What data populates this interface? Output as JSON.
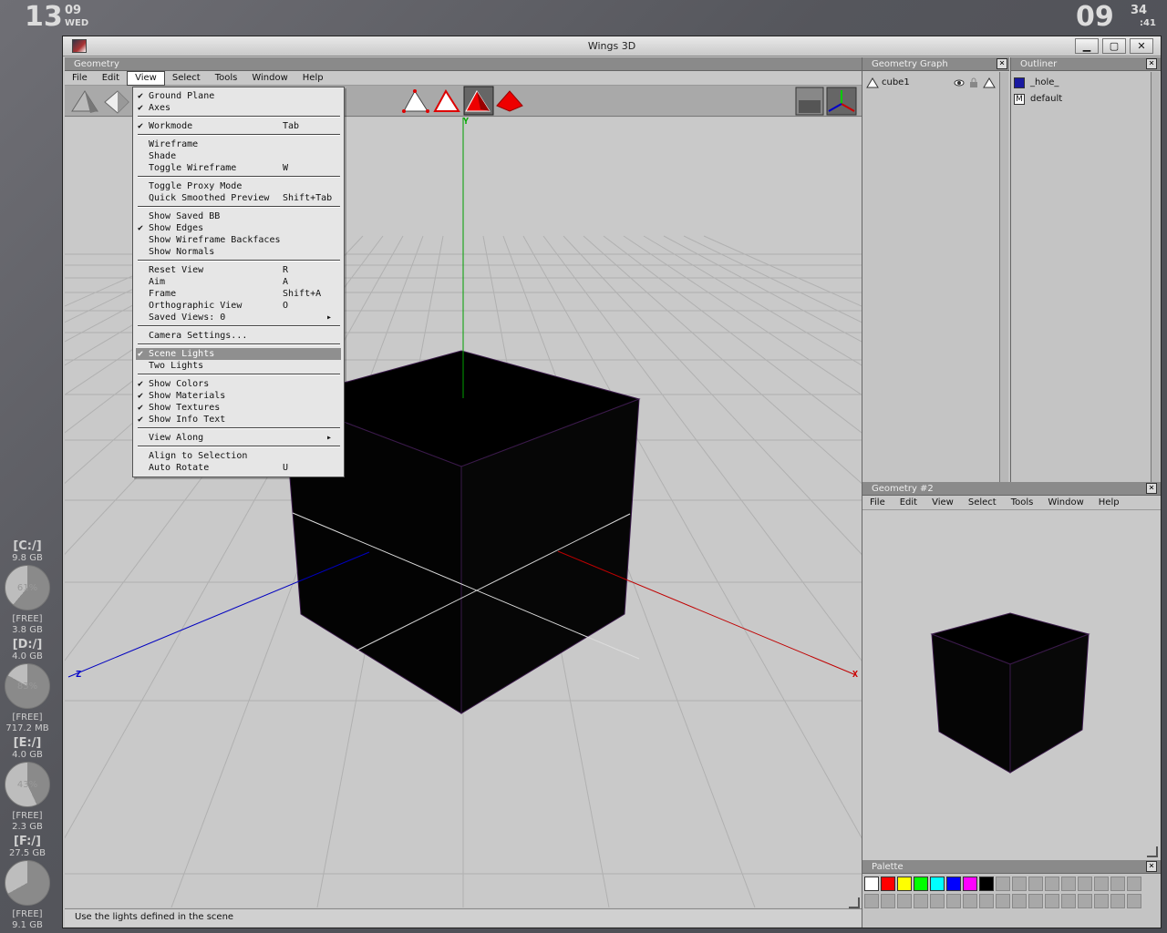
{
  "desktop": {
    "date": {
      "day": "13",
      "month": "09",
      "weekday": "WED"
    },
    "time": {
      "hour": "09",
      "minute": "34",
      "second": ":41"
    },
    "drives": [
      {
        "label": "[C:/]",
        "size": "9.8 GB",
        "pct": "61%",
        "used_fraction": 0.61,
        "free_label": "[FREE]",
        "free": "3.8 GB"
      },
      {
        "label": "[D:/]",
        "size": "4.0 GB",
        "pct": "83%",
        "used_fraction": 0.83,
        "free_label": "[FREE]",
        "free": "717.2 MB"
      },
      {
        "label": "[E:/]",
        "size": "4.0 GB",
        "pct": "43%",
        "used_fraction": 0.43,
        "free_label": "[FREE]",
        "free": "2.3 GB"
      },
      {
        "label": "[F:/]",
        "size": "27.5 GB",
        "pct": "",
        "used_fraction": 0.67,
        "free_label": "[FREE]",
        "free": "9.1 GB"
      }
    ]
  },
  "window": {
    "title": "Wings 3D",
    "buttons": {
      "minimize": "▁",
      "maximize": "▢",
      "close": "✕"
    }
  },
  "geometry_panel": {
    "title": "Geometry",
    "menus": [
      "File",
      "Edit",
      "View",
      "Select",
      "Tools",
      "Window",
      "Help"
    ],
    "axes": {
      "y": "Y",
      "x": "X",
      "z": "Z"
    }
  },
  "view_menu": {
    "items": [
      {
        "check": true,
        "label": "Ground Plane",
        "shortcut": ""
      },
      {
        "check": true,
        "label": "Axes",
        "shortcut": ""
      },
      {
        "sep": true
      },
      {
        "check": true,
        "label": "Workmode",
        "shortcut": "Tab"
      },
      {
        "sep": true
      },
      {
        "check": false,
        "label": "Wireframe",
        "shortcut": ""
      },
      {
        "check": false,
        "label": "Shade",
        "shortcut": ""
      },
      {
        "check": false,
        "label": "Toggle Wireframe",
        "shortcut": "W"
      },
      {
        "sep": true
      },
      {
        "check": false,
        "label": "Toggle Proxy Mode",
        "shortcut": ""
      },
      {
        "check": false,
        "label": "Quick Smoothed Preview",
        "shortcut": "Shift+Tab"
      },
      {
        "sep": true
      },
      {
        "check": false,
        "label": "Show Saved BB",
        "shortcut": ""
      },
      {
        "check": true,
        "label": "Show Edges",
        "shortcut": ""
      },
      {
        "check": false,
        "label": "Show Wireframe Backfaces",
        "shortcut": ""
      },
      {
        "check": false,
        "label": "Show Normals",
        "shortcut": ""
      },
      {
        "sep": true
      },
      {
        "check": false,
        "label": "Reset View",
        "shortcut": "R"
      },
      {
        "check": false,
        "label": "Aim",
        "shortcut": "A"
      },
      {
        "check": false,
        "label": "Frame",
        "shortcut": "Shift+A"
      },
      {
        "check": false,
        "label": "Orthographic View",
        "shortcut": "O"
      },
      {
        "check": false,
        "label": "Saved Views: 0",
        "shortcut": "",
        "submenu": true
      },
      {
        "sep": true
      },
      {
        "check": false,
        "label": "Camera Settings...",
        "shortcut": ""
      },
      {
        "sep": true
      },
      {
        "check": true,
        "label": "Scene Lights",
        "shortcut": "",
        "highlight": true
      },
      {
        "check": false,
        "label": "Two Lights",
        "shortcut": ""
      },
      {
        "sep": true
      },
      {
        "check": true,
        "label": "Show Colors",
        "shortcut": ""
      },
      {
        "check": true,
        "label": "Show Materials",
        "shortcut": ""
      },
      {
        "check": true,
        "label": "Show Textures",
        "shortcut": ""
      },
      {
        "check": true,
        "label": "Show Info Text",
        "shortcut": ""
      },
      {
        "sep": true
      },
      {
        "check": false,
        "label": "View Along",
        "shortcut": "",
        "submenu": true
      },
      {
        "sep": true
      },
      {
        "check": false,
        "label": "Align to Selection",
        "shortcut": ""
      },
      {
        "check": false,
        "label": "Auto Rotate",
        "shortcut": "U"
      }
    ]
  },
  "geometry_graph": {
    "title": "Geometry Graph",
    "objects": [
      {
        "name": "cube1"
      }
    ]
  },
  "outliner": {
    "title": "Outliner",
    "items": [
      {
        "name": "_hole_",
        "icon_color": "#1a1aa0"
      },
      {
        "name": "default",
        "icon": "M"
      }
    ]
  },
  "geometry2": {
    "title": "Geometry #2",
    "menus": [
      "File",
      "Edit",
      "View",
      "Select",
      "Tools",
      "Window",
      "Help"
    ]
  },
  "palette": {
    "title": "Palette",
    "colors": [
      "#ffffff",
      "#ff0000",
      "#ffff00",
      "#00ff00",
      "#00ffff",
      "#0000ff",
      "#ff00ff",
      "#000000"
    ]
  },
  "status": {
    "text": "Use the lights defined in the scene"
  },
  "colors": {
    "x_axis": "#c00000",
    "y_axis": "#00a000",
    "z_axis": "#0000c0",
    "menu_highlight": "#8f8f8f"
  }
}
